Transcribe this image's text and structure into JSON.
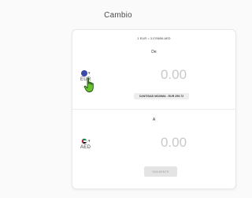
{
  "header": {
    "title": "Cambio"
  },
  "exchange": {
    "rate_text": "1 EUR = 3.076656 AED",
    "from": {
      "label": "De",
      "currency_code": "EUR",
      "flag_icon": "eu-flag-icon",
      "amount": "0.00",
      "max_amount_text": "CANTIDAD MÁXIMA : EUR 259.72"
    },
    "to": {
      "label": "A",
      "currency_code": "AED",
      "flag_icon": "ae-flag-icon",
      "amount": "0.00"
    },
    "next_label": "SIGUIENTE"
  },
  "colors": {
    "background": "#fafafa",
    "card": "#ffffff",
    "amount_placeholder": "#c9c9c9",
    "button_disabled": "#e4e4e4",
    "cursor_hand": "#6ac22f"
  }
}
